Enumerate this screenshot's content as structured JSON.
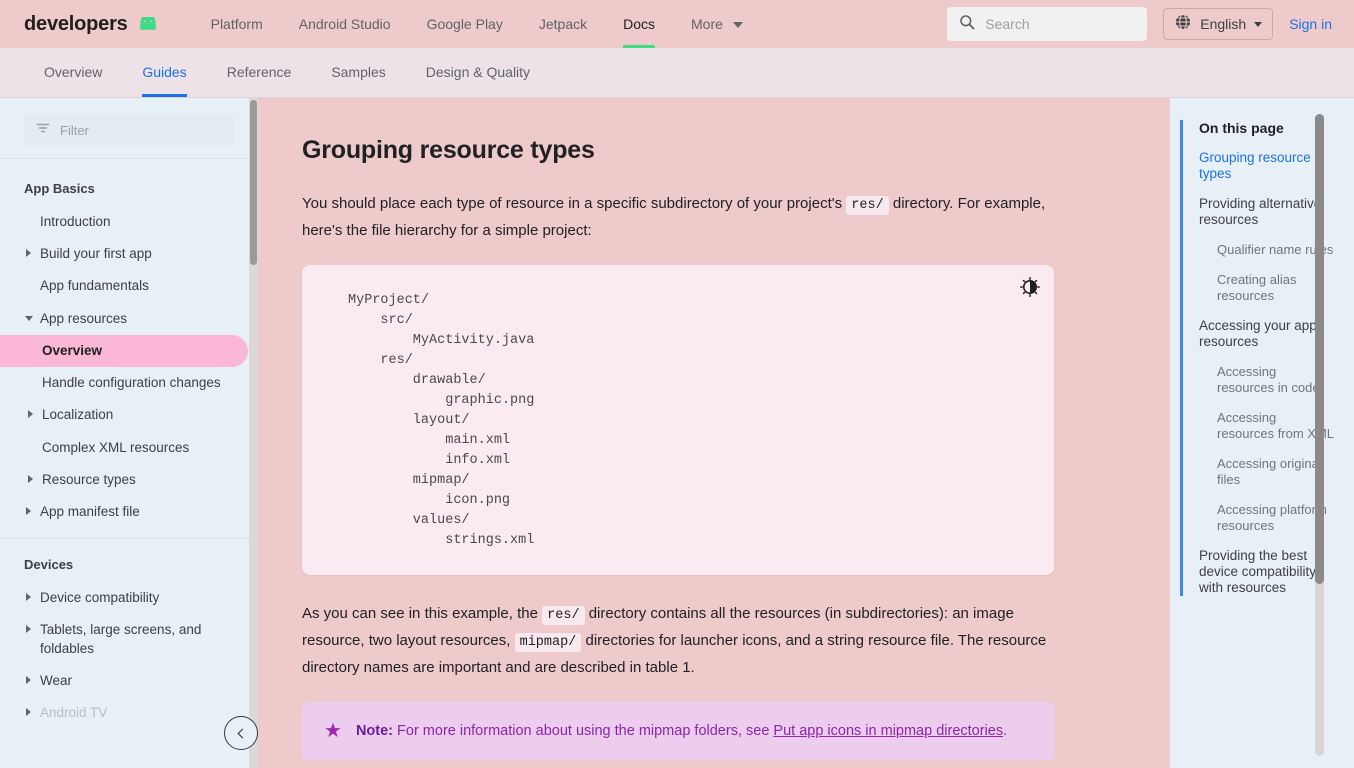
{
  "header": {
    "brand": "developers",
    "logo_icon": "android-robot-logo",
    "nav": [
      {
        "label": "Platform",
        "active": false,
        "caret": false
      },
      {
        "label": "Android Studio",
        "active": false,
        "caret": false
      },
      {
        "label": "Google Play",
        "active": false,
        "caret": false
      },
      {
        "label": "Jetpack",
        "active": false,
        "caret": false
      },
      {
        "label": "Docs",
        "active": true,
        "caret": false
      },
      {
        "label": "More",
        "active": false,
        "caret": true
      }
    ],
    "search": {
      "placeholder": "Search",
      "value": "",
      "icon": "search-icon"
    },
    "language": {
      "label": "English",
      "icon": "globe-icon"
    },
    "signin": "Sign in"
  },
  "tabs": [
    {
      "label": "Overview",
      "active": false
    },
    {
      "label": "Guides",
      "active": true
    },
    {
      "label": "Reference",
      "active": false
    },
    {
      "label": "Samples",
      "active": false
    },
    {
      "label": "Design & Quality",
      "active": false
    }
  ],
  "sidebar": {
    "filter": {
      "placeholder": "Filter",
      "value": "",
      "icon": "filter-icon"
    },
    "sections": [
      {
        "title": "App Basics",
        "items": [
          {
            "label": "Introduction",
            "arrow": "none",
            "indent": false,
            "selected": false
          },
          {
            "label": "Build your first app",
            "arrow": "right",
            "indent": false,
            "selected": false
          },
          {
            "label": "App fundamentals",
            "arrow": "none",
            "indent": false,
            "selected": false
          },
          {
            "label": "App resources",
            "arrow": "down",
            "indent": false,
            "selected": false
          },
          {
            "label": "Overview",
            "arrow": "none",
            "indent": true,
            "selected": true
          },
          {
            "label": "Handle configuration changes",
            "arrow": "none",
            "indent": true,
            "selected": false
          },
          {
            "label": "Localization",
            "arrow": "right",
            "indent": true,
            "selected": false
          },
          {
            "label": "Complex XML resources",
            "arrow": "none",
            "indent": true,
            "selected": false
          },
          {
            "label": "Resource types",
            "arrow": "right",
            "indent": true,
            "selected": false
          },
          {
            "label": "App manifest file",
            "arrow": "right",
            "indent": false,
            "selected": false
          }
        ]
      },
      {
        "title": "Devices",
        "items": [
          {
            "label": "Device compatibility",
            "arrow": "right",
            "indent": false,
            "selected": false
          },
          {
            "label": "Tablets, large screens, and foldables",
            "arrow": "right",
            "indent": false,
            "selected": false
          },
          {
            "label": "Wear",
            "arrow": "right",
            "indent": false,
            "selected": false
          },
          {
            "label": "Android TV",
            "arrow": "right",
            "indent": false,
            "selected": false,
            "faded": true
          }
        ]
      }
    ],
    "collapse_button_icon": "chevron-left-icon"
  },
  "main": {
    "title": "Grouping resource types",
    "para1_a": "You should place each type of resource in a specific subdirectory of your project's ",
    "para1_code": "res/",
    "para1_b": " directory. For example, here's the file hierarchy for a simple project:",
    "code": "MyProject/\n    src/\n        MyActivity.java\n    res/\n        drawable/\n            graphic.png\n        layout/\n            main.xml\n            info.xml\n        mipmap/\n            icon.png\n        values/\n            strings.xml",
    "code_toggle_icon": "brightness-contrast-icon",
    "para2_a": "As you can see in this example, the ",
    "para2_code1": "res/",
    "para2_b": " directory contains all the resources (in subdirectories): an image resource, two layout resources, ",
    "para2_code2": "mipmap/",
    "para2_c": " directories for launcher icons, and a string resource file. The resource directory names are important and are described in table 1.",
    "note": {
      "icon": "star-icon",
      "label": "Note:",
      "text_a": " For more information about using the mipmap folders, see ",
      "link": "Put app icons in mipmap directories",
      "text_b": "."
    }
  },
  "toc": {
    "title": "On this page",
    "items": [
      {
        "label": "Grouping resource types",
        "active": true,
        "sub": false
      },
      {
        "label": "Providing alternative resources",
        "active": false,
        "sub": false
      },
      {
        "label": "Qualifier name rules",
        "active": false,
        "sub": true
      },
      {
        "label": "Creating alias resources",
        "active": false,
        "sub": true
      },
      {
        "label": "Accessing your app resources",
        "active": false,
        "sub": false
      },
      {
        "label": "Accessing resources in code",
        "active": false,
        "sub": true
      },
      {
        "label": "Accessing resources from XML",
        "active": false,
        "sub": true
      },
      {
        "label": "Accessing original files",
        "active": false,
        "sub": true
      },
      {
        "label": "Accessing platform resources",
        "active": false,
        "sub": true
      },
      {
        "label": "Providing the best device compatibility with resources",
        "active": false,
        "sub": false
      }
    ]
  },
  "colors": {
    "header_bg": "#eecacb",
    "tabs_bg": "#ece2e8",
    "sidebar_bg": "#e8f0f7",
    "content_bg": "#eecacb",
    "code_bg": "#faeaf2",
    "note_bg": "#edcded",
    "accent_blue": "#1a73e8",
    "accent_green": "#3ddc84",
    "selected_pink": "#fbb7d6",
    "note_purple": "#8e24aa"
  }
}
